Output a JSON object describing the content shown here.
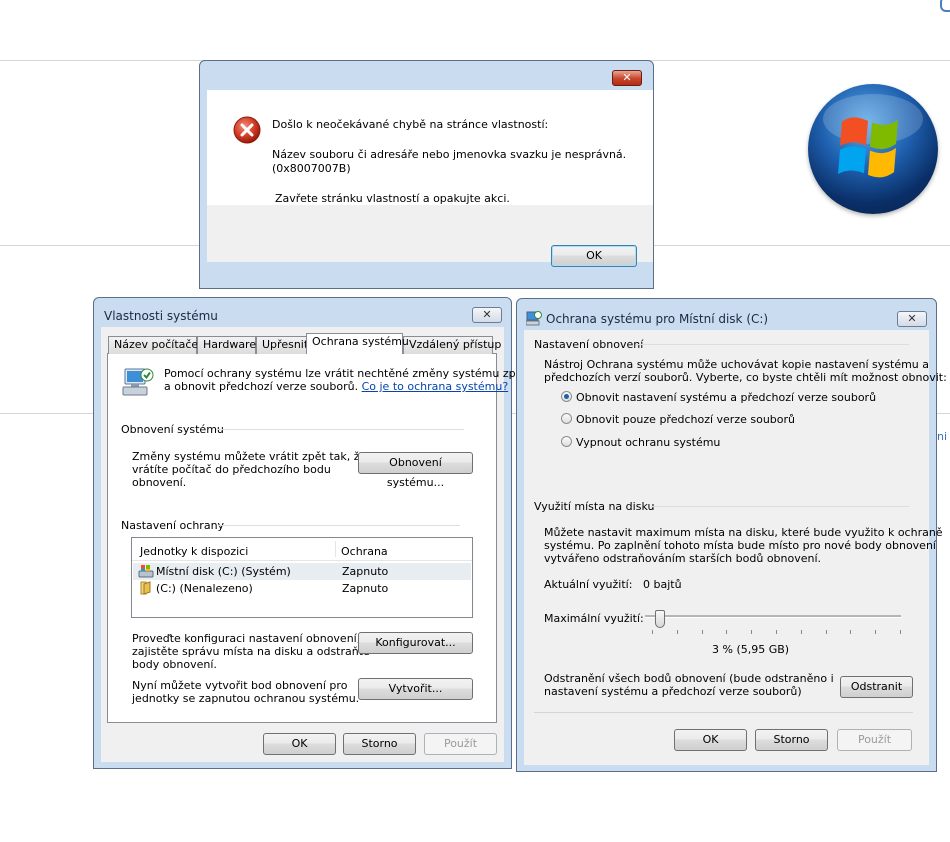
{
  "background": {
    "side_fragment": "ni"
  },
  "error_dialog": {
    "heading": "Došlo k neočekávané chybě na stránce vlastností:",
    "message_line1": "Název souboru či adresáře nebo jmenovka svazku je nesprávná.",
    "message_line2": "(0x8007007B)",
    "message_line3": "Zavřete stránku vlastností a opakujte akci.",
    "ok_label": "OK",
    "close_label": "✕",
    "icon": "error-x-icon"
  },
  "system_properties": {
    "title": "Vlastnosti systému",
    "close_label": "✕",
    "tabs": [
      {
        "label": "Název počítače"
      },
      {
        "label": "Hardware"
      },
      {
        "label": "Upřesnit"
      },
      {
        "label": "Ochrana systému"
      },
      {
        "label": "Vzdálený přístup"
      }
    ],
    "active_tab": "Ochrana systému",
    "intro_line1": "Pomocí ochrany systému lze vrátit nechtěné změny systému zpět",
    "intro_line2": "a obnovit předchozí verze souborů.",
    "intro_link": "Co je to ochrana systému?",
    "restore_group": "Obnovení systému",
    "restore_text1": "Změny systému můžete vrátit zpět tak, že",
    "restore_text2": "vrátíte počítač do předchozího bodu",
    "restore_text3": "obnovení.",
    "restore_button": "Obnovení systému...",
    "protection_group": "Nastavení ochrany",
    "list_headers": {
      "drive": "Jednotky k dispozici",
      "protection": "Ochrana"
    },
    "drives": [
      {
        "name": "Místní disk (C:) (Systém)",
        "protection": "Zapnuto"
      },
      {
        "name": "(C:) (Nenalezeno)",
        "protection": "Zapnuto"
      }
    ],
    "configure_text1": "Proveďte konfiguraci nastavení obnovení,",
    "configure_text2": "zajistěte správu místa na disku a odstraňte",
    "configure_text3": "body obnovení.",
    "configure_button": "Konfigurovat...",
    "create_text1": "Nyní můžete vytvořit bod obnovení pro",
    "create_text2": "jednotky se zapnutou ochranou systému.",
    "create_button": "Vytvořit...",
    "ok_label": "OK",
    "cancel_label": "Storno",
    "apply_label": "Použít"
  },
  "disk_protection": {
    "title": "Ochrana systému pro Místní disk (C:)",
    "close_label": "✕",
    "restore_settings_group": "Nastavení obnovení",
    "restore_desc1": "Nástroj Ochrana systému může uchovávat kopie nastavení systému a",
    "restore_desc2": "předchozích verzí souborů. Vyberte, co byste chtěli mít možnost obnovit:",
    "options": [
      {
        "label": "Obnovit nastavení systému a předchozí verze souborů",
        "selected": true
      },
      {
        "label": "Obnovit pouze předchozí verze souborů",
        "selected": false
      },
      {
        "label": "Vypnout ochranu systému",
        "selected": false
      }
    ],
    "disk_usage_group": "Využití místa na disku",
    "usage_desc1": "Můžete nastavit maximum místa na disku, které bude využito k ochraně",
    "usage_desc2": "systému. Po zaplnění tohoto místa bude místo pro nové body obnovení",
    "usage_desc3": "vytvářeno odstraňováním starších bodů obnovení.",
    "current_usage_label": "Aktuální využití:",
    "current_usage_value": "0 bajtů",
    "max_usage_label": "Maximální využití:",
    "max_usage_percent": 3,
    "max_usage_value": "3 % (5,95 GB)",
    "delete_text1": "Odstranění všech bodů obnovení (bude odstraněno i",
    "delete_text2": "nastavení systému a předchozí verze souborů)",
    "delete_button": "Odstranit",
    "ok_label": "OK",
    "cancel_label": "Storno",
    "apply_label": "Použít"
  },
  "colors": {
    "window_frame": "#c9dcf0",
    "link": "#0645ad",
    "radio_dot": "#1e5fa8",
    "error_red": "#c7452c"
  }
}
